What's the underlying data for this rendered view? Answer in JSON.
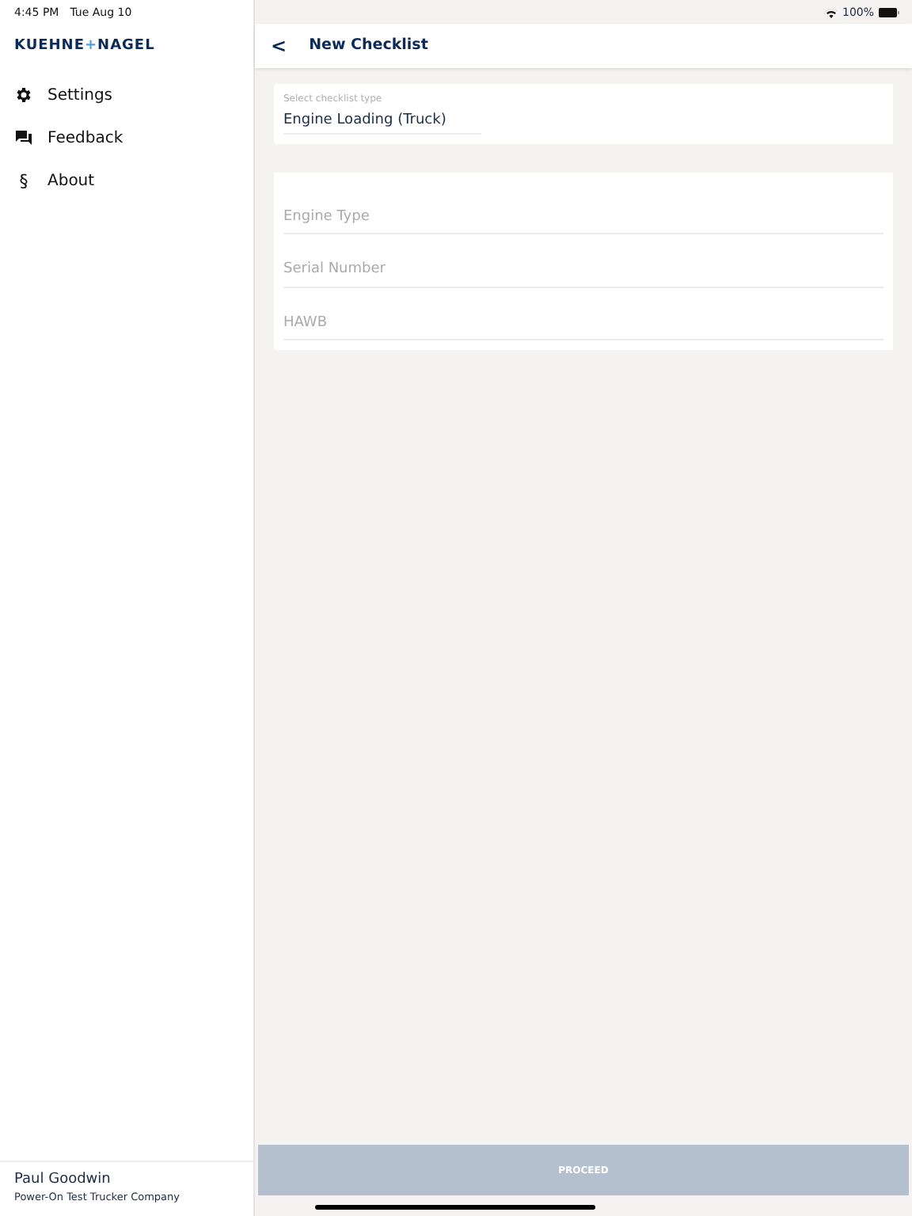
{
  "status_bar": {
    "time": "4:45 PM",
    "date": "Tue Aug 10",
    "battery": "100%"
  },
  "sidebar": {
    "logo": {
      "left": "KUEHNE",
      "joiner": "+",
      "right": "NAGEL"
    },
    "items": [
      {
        "label": "Settings",
        "kind": "gear"
      },
      {
        "label": "Feedback",
        "kind": "chat"
      },
      {
        "label": "About",
        "kind": "section",
        "glyph": "§"
      }
    ],
    "user": {
      "name": "Paul Goodwin",
      "company": "Power-On Test Trucker Company"
    }
  },
  "header": {
    "back": "<",
    "title": "New Checklist"
  },
  "checklist_type": {
    "label": "Select checklist type",
    "value": "Engine Loading (Truck)"
  },
  "fields": [
    {
      "placeholder": "Engine Type"
    },
    {
      "placeholder": "Serial Number"
    },
    {
      "placeholder": "HAWB"
    }
  ],
  "proceed": {
    "label": "PROCEED",
    "disabled": true
  }
}
